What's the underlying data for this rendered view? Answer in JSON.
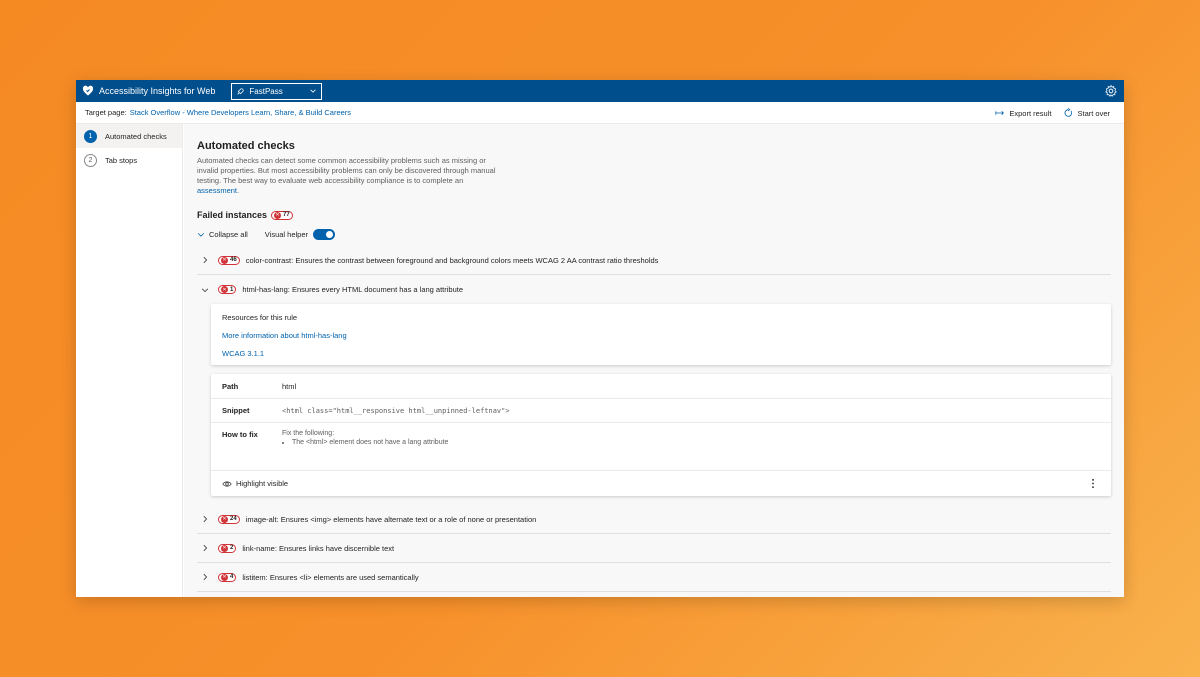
{
  "titlebar": {
    "app_title": "Accessibility Insights for Web",
    "mode": "FastPass"
  },
  "target": {
    "label": "Target page:",
    "link": "Stack Overflow - Where Developers Learn, Share, & Build Careers",
    "export": "Export result",
    "start_over": "Start over"
  },
  "sidebar": {
    "items": [
      {
        "num": "1",
        "label": "Automated checks"
      },
      {
        "num": "2",
        "label": "Tab stops"
      }
    ]
  },
  "main": {
    "title": "Automated checks",
    "desc": "Automated checks can detect some common accessibility problems such as missing or invalid properties. But most accessibility problems can only be discovered through manual testing. The best way to evaluate web accessibility compliance is to complete an",
    "desc_link": "assessment",
    "failed_label": "Failed instances",
    "failed_count": "77",
    "collapse_all": "Collapse all",
    "visual_helper": "Visual helper"
  },
  "rules": [
    {
      "count": "46",
      "id": "color-contrast:",
      "text": "Ensures the contrast between foreground and background colors meets WCAG 2 AA contrast ratio thresholds"
    },
    {
      "count": "1",
      "id": "html-has-lang:",
      "text": "Ensures every HTML document has a lang attribute"
    },
    {
      "count": "24",
      "id": "image-alt:",
      "text": "Ensures <img> elements have alternate text or a role of none or presentation"
    },
    {
      "count": "2",
      "id": "link-name:",
      "text": "Ensures links have discernible text"
    },
    {
      "count": "4",
      "id": "listitem:",
      "text": "Ensures <li> elements are used semantically"
    }
  ],
  "expanded": {
    "resources_title": "Resources for this rule",
    "more_info": "More information about html-has-lang",
    "wcag": "WCAG 3.1.1",
    "path_label": "Path",
    "path_value": "html",
    "snippet_label": "Snippet",
    "snippet_value": "<html class=\"html__responsive html__unpinned-leftnav\">",
    "howto_label": "How to fix",
    "howto_intro": "Fix the following:",
    "howto_item": "The <html> element does not have a lang attribute",
    "highlight": "Highlight visible"
  }
}
